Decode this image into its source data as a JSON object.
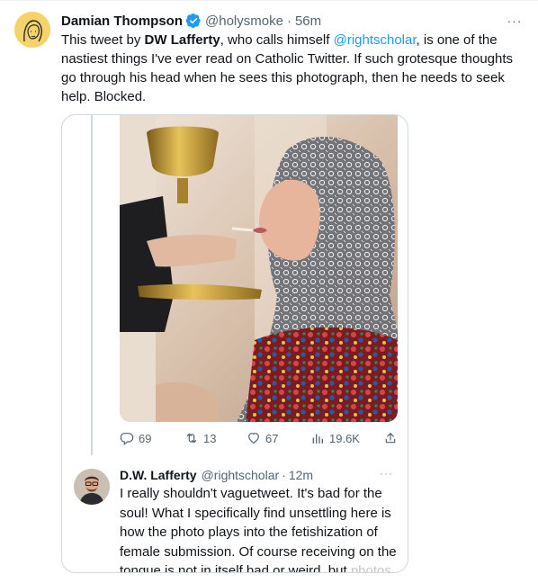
{
  "tweet": {
    "author_name": "Damian Thompson",
    "author_handle": "@holysmoke",
    "separator": "·",
    "time": "56m",
    "more_glyph": "···",
    "text": {
      "p1": "This tweet by ",
      "bold_name": "DW Lafferty",
      "p2": ", who calls himself ",
      "mention": "@rightscholar",
      "p3": ",  is one of the nastiest things I've ever read on Catholic Twitter. If such grotesque thoughts go through his head when he sees this photograph, then he needs to seek help. Blocked."
    }
  },
  "screenshot": {
    "metrics": {
      "replies": "69",
      "retweets": "13",
      "likes": "67",
      "views": "19.6K"
    },
    "quoted": {
      "author_name": "D.W. Lafferty",
      "author_handle": "@rightscholar",
      "separator": "·",
      "time": "12m",
      "more_glyph": "···",
      "text_visible": "I really shouldn't vaguetweet. It's bad for the soul! What I specifically find unsettling here is how the photo plays into the fetishization of female submission. Of course receiving on the tongue is not in itself bad or weird, but",
      "text_cut": "photos like this have a peculiar look to"
    }
  },
  "colors": {
    "accent": "#1d9bf0",
    "secondary_text": "#536471",
    "border": "#cfd9de"
  },
  "icons": {
    "verified": "verified-badge-icon",
    "reply": "reply-icon",
    "retweet": "retweet-icon",
    "like": "heart-icon",
    "views": "views-chart-icon",
    "share": "share-icon",
    "more": "more-dots-icon"
  }
}
